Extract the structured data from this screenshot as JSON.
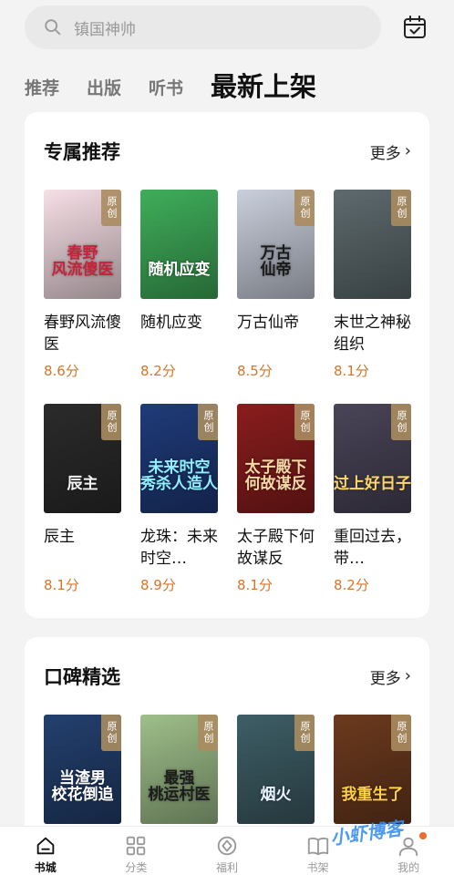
{
  "search": {
    "placeholder": "镇国神帅"
  },
  "tabs": [
    {
      "label": "推荐"
    },
    {
      "label": "出版"
    },
    {
      "label": "听书"
    },
    {
      "label": "最新上架"
    }
  ],
  "sections": [
    {
      "title": "专属推荐",
      "more": "更多",
      "books": [
        {
          "name": "春野风流傻医",
          "score": "8.6分",
          "badge": "原创",
          "cover_text": "春野\n风流傻医",
          "bg": "#f7dfe6",
          "fg": "#c8233a"
        },
        {
          "name": "随机应变",
          "score": "8.2分",
          "badge": "",
          "cover_text": "随机应变",
          "bg": "#3fae5a",
          "fg": "#ffffff"
        },
        {
          "name": "万古仙帝",
          "score": "8.5分",
          "badge": "原创",
          "cover_text": "万古\n仙帝",
          "bg": "#c9cfdc",
          "fg": "#1a1a1a"
        },
        {
          "name": "末世之神秘组织",
          "score": "8.1分",
          "badge": "原创",
          "cover_text": "",
          "bg": "#5e6a6e",
          "fg": "#ffffff"
        },
        {
          "name": "辰主",
          "score": "8.1分",
          "badge": "原创",
          "cover_text": "辰主",
          "bg": "#2b2b2b",
          "fg": "#f2f2f2"
        },
        {
          "name": "龙珠：未来时空…",
          "score": "8.9分",
          "badge": "原创",
          "cover_text": "未来时空\n秀杀人造人",
          "bg": "#1f3b7a",
          "fg": "#8ff0ff"
        },
        {
          "name": "太子殿下何故谋反",
          "score": "8.1分",
          "badge": "原创",
          "cover_text": "太子殿下\n何故谋反",
          "bg": "#8a1d1d",
          "fg": "#f3d9a5"
        },
        {
          "name": "重回过去，带…",
          "score": "8.2分",
          "badge": "原创",
          "cover_text": "过上好日子",
          "bg": "#4a4458",
          "fg": "#ffd86b"
        }
      ]
    },
    {
      "title": "口碑精选",
      "more": "更多",
      "books": [
        {
          "name": "",
          "score": "",
          "badge": "原创",
          "cover_text": "当渣男\n校花倒追",
          "bg": "#23406e",
          "fg": "#ffffff"
        },
        {
          "name": "",
          "score": "",
          "badge": "原创",
          "cover_text": "最强\n桃运村医",
          "bg": "#9ebf8a",
          "fg": "#1d1d1d"
        },
        {
          "name": "",
          "score": "",
          "badge": "原创",
          "cover_text": "烟火",
          "bg": "#3e5e66",
          "fg": "#e8f3ff"
        },
        {
          "name": "",
          "score": "",
          "badge": "原创",
          "cover_text": "我重生了",
          "bg": "#6c3a1e",
          "fg": "#ffd04a"
        }
      ]
    }
  ],
  "nav": [
    {
      "label": "书城",
      "icon": "bookstore-icon",
      "active": true
    },
    {
      "label": "分类",
      "icon": "category-icon",
      "active": false
    },
    {
      "label": "福利",
      "icon": "welfare-icon",
      "active": false
    },
    {
      "label": "书架",
      "icon": "bookshelf-icon",
      "active": false
    },
    {
      "label": "我的",
      "icon": "profile-icon",
      "active": false
    }
  ],
  "watermark": "小虾博客",
  "colors": {
    "accent": "#d4762c",
    "badge": "#aa8c5f",
    "notify_dot": "#f06a2a"
  }
}
